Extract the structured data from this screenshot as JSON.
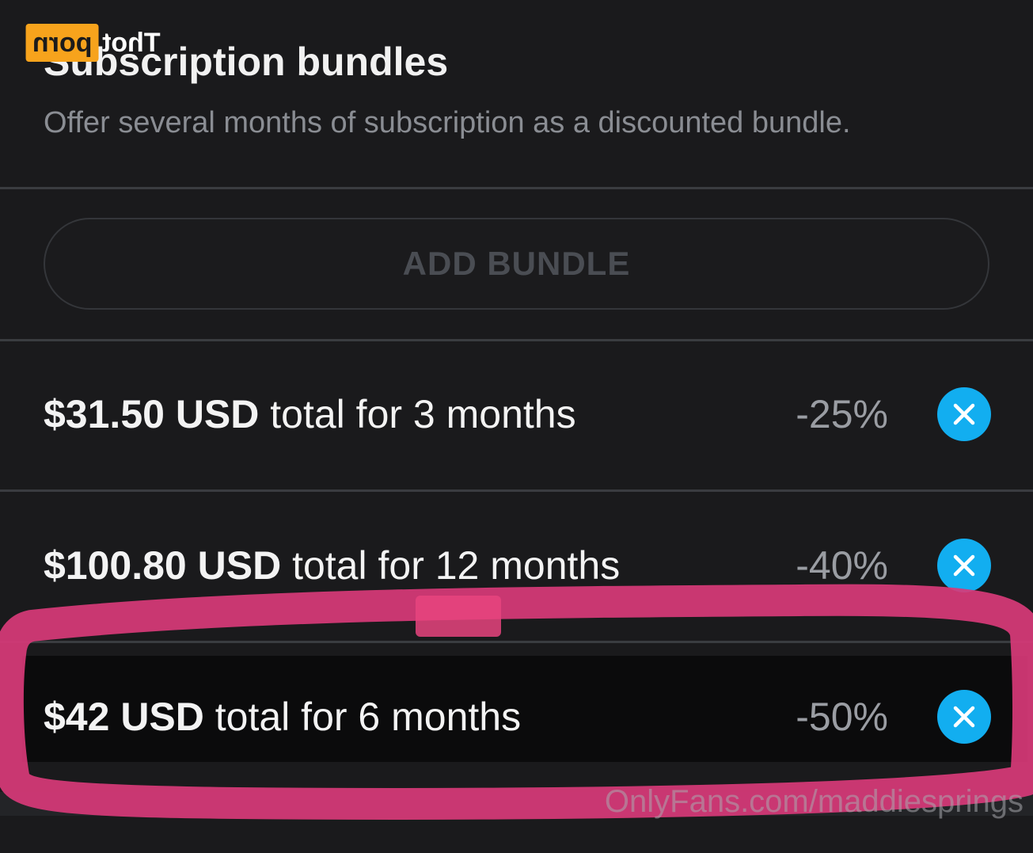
{
  "header": {
    "title": "Subscription bundles",
    "subtitle": "Offer several months of subscription as a discounted bundle."
  },
  "add_bundle": {
    "label": "ADD BUNDLE"
  },
  "bundles": [
    {
      "price": "$31.50 USD",
      "rest": " total for 3 months",
      "discount": "-25%"
    },
    {
      "price": "$100.80 USD",
      "rest": " total for 12 months",
      "discount": "-40%"
    },
    {
      "price": "$42 USD",
      "rest": " total for 6 months",
      "discount": "-50%"
    }
  ],
  "icons": {
    "remove": "close-icon"
  },
  "colors": {
    "background": "#1a1a1c",
    "accent": "#12aef0",
    "highlight_marker": "#d83a78"
  },
  "watermarks": {
    "logo_text_a": "Thot",
    "logo_text_b": "porn",
    "site": "OnlyFans.com/maddiesprings"
  }
}
